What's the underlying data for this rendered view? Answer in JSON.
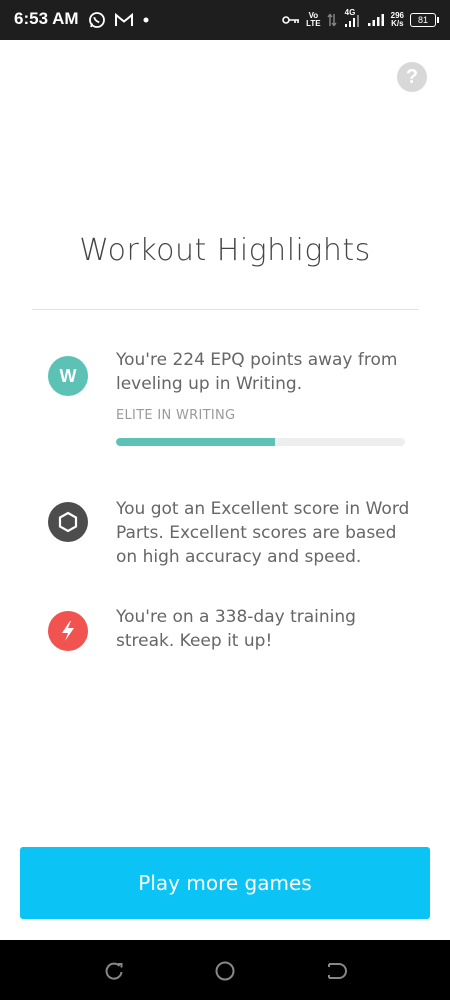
{
  "status_bar": {
    "time": "6:53 AM",
    "left_icons": [
      "whatsapp-icon",
      "gmail-icon",
      "notification-dot-icon"
    ],
    "network_top": "Vo",
    "network_bottom": "LTE",
    "network_gen": "4G",
    "speed_value": "296",
    "speed_unit": "K/s",
    "battery": "81"
  },
  "help": {
    "icon": "?"
  },
  "title": "Workout Highlights",
  "highlights": [
    {
      "icon_letter": "W",
      "icon_color": "#5cc2b6",
      "text": "You're 224 EPQ points away from leveling up in Writing.",
      "level_label": "ELITE IN WRITING",
      "progress": 0.55
    },
    {
      "icon": "hexagon-icon",
      "icon_color": "#4d4d4d",
      "text": "You got an Excellent score in Word Parts. Excellent scores are based on high accuracy and speed."
    },
    {
      "icon": "lightning-bolt-icon",
      "icon_color": "#f15350",
      "text": "You're on a 338-day training streak. Keep it up!"
    }
  ],
  "cta": {
    "label": "Play more games",
    "color": "#0cc3f5"
  },
  "nav": {
    "items": [
      "recent-apps-icon",
      "home-icon",
      "back-icon"
    ]
  }
}
